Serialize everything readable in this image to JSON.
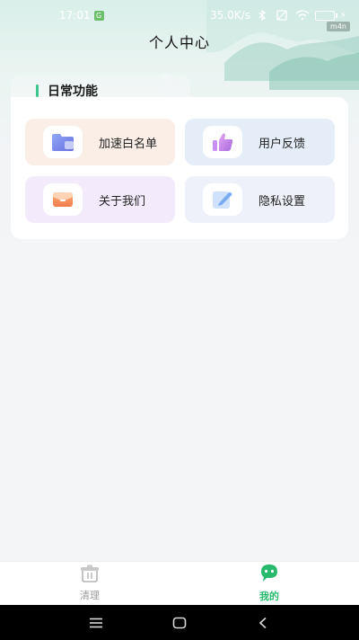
{
  "status_bar": {
    "time": "17:01",
    "network_speed": "35.0K/s",
    "carrier_tag": "m4n"
  },
  "header": {
    "title": "个人中心"
  },
  "daily_functions": {
    "title": "日常功能",
    "items": [
      {
        "label": "加速白名单",
        "icon": "folder-icon"
      },
      {
        "label": "用户反馈",
        "icon": "thumbs-up-icon"
      },
      {
        "label": "关于我们",
        "icon": "envelope-icon"
      },
      {
        "label": "隐私设置",
        "icon": "edit-icon"
      }
    ]
  },
  "tabbar": {
    "items": [
      {
        "label": "清理",
        "icon": "trash-icon",
        "active": false
      },
      {
        "label": "我的",
        "icon": "chat-face-icon",
        "active": true
      }
    ]
  },
  "colors": {
    "accent": "#27b96c",
    "section_bar": "#3cc68f"
  }
}
